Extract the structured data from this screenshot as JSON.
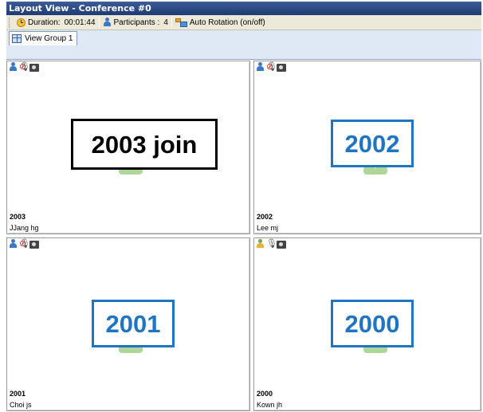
{
  "window": {
    "title": "Layout View - Conference #0"
  },
  "toolbar": {
    "duration_label": "Duration:",
    "duration_value": "00:01:44",
    "participants_label": "Participants :",
    "participants_value": "4",
    "auto_rotation_label": "Auto Rotation (on/off)"
  },
  "tabs": [
    {
      "label": "View Group 1",
      "active": true
    }
  ],
  "panels": [
    {
      "id": "2003",
      "name": "JJang hg",
      "callout": "2003 join",
      "callout_color": "#000000",
      "mic_muted": true,
      "status_icon": "user-blue"
    },
    {
      "id": "2002",
      "name": "Lee mj",
      "callout": "2002",
      "callout_color": "#1f74c4",
      "mic_muted": true,
      "status_icon": "user-blue"
    },
    {
      "id": "2001",
      "name": "Choi js",
      "callout": "2001",
      "callout_color": "#1f74c4",
      "mic_muted": true,
      "status_icon": "user-blue"
    },
    {
      "id": "2000",
      "name": "Kown jh",
      "callout": "2000",
      "callout_color": "#1f74c4",
      "mic_muted": false,
      "status_icon": "user-green"
    }
  ],
  "colors": {
    "title_bar": "#1f3a73",
    "callout_blue": "#1f74c4",
    "tab_strip": "#dfe8f5"
  }
}
